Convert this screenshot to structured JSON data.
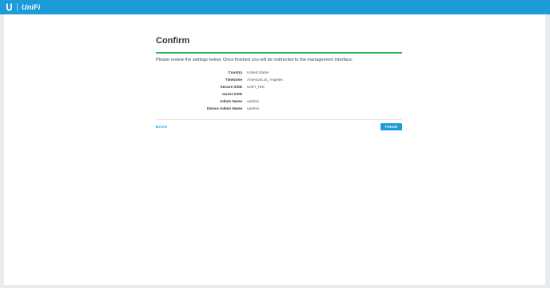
{
  "app": {
    "logo_text": "UniFi",
    "accent_color": "#1b9bd8",
    "success_color": "#2eb75a"
  },
  "confirm": {
    "title": "Confirm",
    "description": "Please review the settings below. Once finished you will be redirected to the management interface.",
    "rows": [
      {
        "label": "Country",
        "value": "United States"
      },
      {
        "label": "Timezone",
        "value": "America/Los_Angeles"
      },
      {
        "label": "Secure SSID",
        "value": "UniFi_Test"
      },
      {
        "label": "Guest SSID",
        "value": "-"
      },
      {
        "label": "Admin Name",
        "value": "uadmin"
      },
      {
        "label": "Device Admin Name",
        "value": "uadmin"
      }
    ],
    "back_label": "BACK",
    "finish_label": "FINISH"
  },
  "icons": {
    "logo": "ubiquiti-u-logo-icon"
  }
}
